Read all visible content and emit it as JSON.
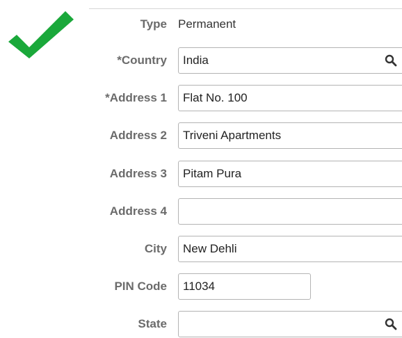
{
  "form": {
    "type": {
      "label": "Type",
      "value": "Permanent"
    },
    "fields": [
      {
        "key": "country",
        "label": "*Country",
        "value": "India",
        "lookup": true
      },
      {
        "key": "address1",
        "label": "*Address 1",
        "value": "Flat No. 100"
      },
      {
        "key": "address2",
        "label": "Address 2",
        "value": "Triveni Apartments"
      },
      {
        "key": "address3",
        "label": "Address 3",
        "value": "Pitam Pura"
      },
      {
        "key": "address4",
        "label": "Address 4",
        "value": ""
      },
      {
        "key": "city",
        "label": "City",
        "value": "New Dehli"
      },
      {
        "key": "pin",
        "label": "PIN Code",
        "value": "11034"
      },
      {
        "key": "state",
        "label": "State",
        "value": "",
        "lookup": true
      }
    ]
  },
  "icons": {
    "status": "checkmark-icon",
    "lookup": "search-icon"
  },
  "colors": {
    "check": "#1aa83a",
    "label": "#6b6b6b",
    "border": "#b3b3b3"
  }
}
